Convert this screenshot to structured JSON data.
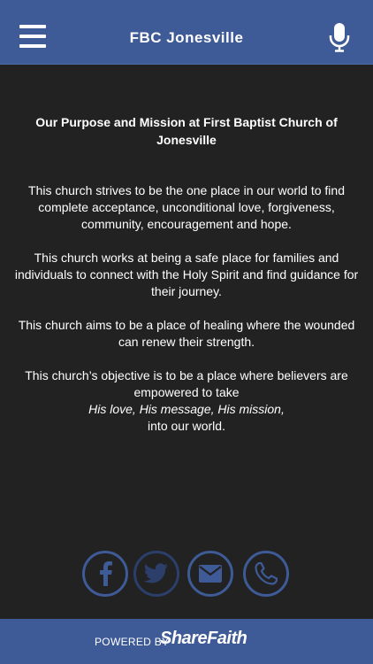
{
  "header": {
    "title": "FBC Jonesville"
  },
  "content": {
    "heading": "Our Purpose and Mission at First Baptist Church of Jonesville",
    "para1": "This church strives to be the one place in our world to find complete acceptance, unconditional love, forgiveness, community, encouragement and hope.",
    "para2": "This church works at being a safe place for families and individuals to connect with the Holy Spirit and find guidance for their journey.",
    "para3": "This church aims to be a place of healing where the wounded can renew their strength.",
    "para4_line1": "This church’s objective is to be a place where believers are empowered to take",
    "para4_line2": "His love, His message, His mission,",
    "para4_line3": "into our world."
  },
  "social": {
    "items": [
      "facebook-icon",
      "twitter-icon",
      "email-icon",
      "phone-icon"
    ],
    "accent": "#3e5a97"
  },
  "footer": {
    "powered_by": "POWERED BY",
    "brand": "ShareFaith"
  },
  "colors": {
    "header_bg": "#3e5a97",
    "body_bg": "#222222",
    "text": "#ffffff"
  }
}
